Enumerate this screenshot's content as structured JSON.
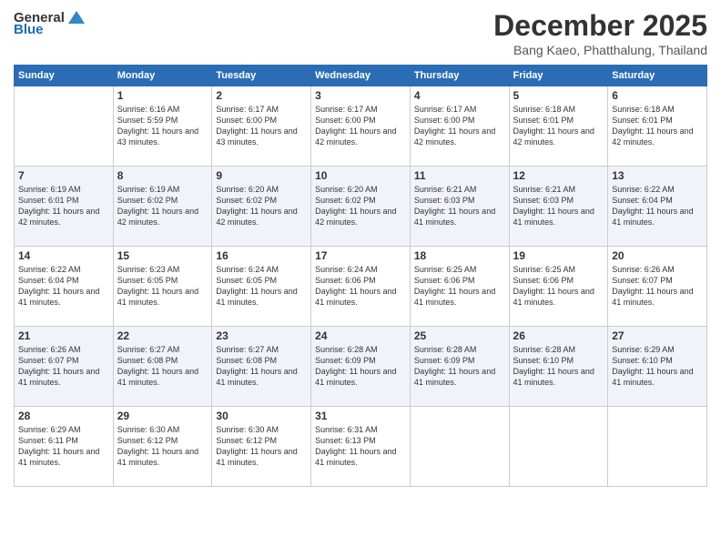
{
  "header": {
    "logo_general": "General",
    "logo_blue": "Blue",
    "month_year": "December 2025",
    "location": "Bang Kaeo, Phatthalung, Thailand"
  },
  "weekdays": [
    "Sunday",
    "Monday",
    "Tuesday",
    "Wednesday",
    "Thursday",
    "Friday",
    "Saturday"
  ],
  "weeks": [
    [
      {
        "day": "",
        "sunrise": "",
        "sunset": "",
        "daylight": ""
      },
      {
        "day": "1",
        "sunrise": "Sunrise: 6:16 AM",
        "sunset": "Sunset: 5:59 PM",
        "daylight": "Daylight: 11 hours and 43 minutes."
      },
      {
        "day": "2",
        "sunrise": "Sunrise: 6:17 AM",
        "sunset": "Sunset: 6:00 PM",
        "daylight": "Daylight: 11 hours and 43 minutes."
      },
      {
        "day": "3",
        "sunrise": "Sunrise: 6:17 AM",
        "sunset": "Sunset: 6:00 PM",
        "daylight": "Daylight: 11 hours and 42 minutes."
      },
      {
        "day": "4",
        "sunrise": "Sunrise: 6:17 AM",
        "sunset": "Sunset: 6:00 PM",
        "daylight": "Daylight: 11 hours and 42 minutes."
      },
      {
        "day": "5",
        "sunrise": "Sunrise: 6:18 AM",
        "sunset": "Sunset: 6:01 PM",
        "daylight": "Daylight: 11 hours and 42 minutes."
      },
      {
        "day": "6",
        "sunrise": "Sunrise: 6:18 AM",
        "sunset": "Sunset: 6:01 PM",
        "daylight": "Daylight: 11 hours and 42 minutes."
      }
    ],
    [
      {
        "day": "7",
        "sunrise": "Sunrise: 6:19 AM",
        "sunset": "Sunset: 6:01 PM",
        "daylight": "Daylight: 11 hours and 42 minutes."
      },
      {
        "day": "8",
        "sunrise": "Sunrise: 6:19 AM",
        "sunset": "Sunset: 6:02 PM",
        "daylight": "Daylight: 11 hours and 42 minutes."
      },
      {
        "day": "9",
        "sunrise": "Sunrise: 6:20 AM",
        "sunset": "Sunset: 6:02 PM",
        "daylight": "Daylight: 11 hours and 42 minutes."
      },
      {
        "day": "10",
        "sunrise": "Sunrise: 6:20 AM",
        "sunset": "Sunset: 6:02 PM",
        "daylight": "Daylight: 11 hours and 42 minutes."
      },
      {
        "day": "11",
        "sunrise": "Sunrise: 6:21 AM",
        "sunset": "Sunset: 6:03 PM",
        "daylight": "Daylight: 11 hours and 41 minutes."
      },
      {
        "day": "12",
        "sunrise": "Sunrise: 6:21 AM",
        "sunset": "Sunset: 6:03 PM",
        "daylight": "Daylight: 11 hours and 41 minutes."
      },
      {
        "day": "13",
        "sunrise": "Sunrise: 6:22 AM",
        "sunset": "Sunset: 6:04 PM",
        "daylight": "Daylight: 11 hours and 41 minutes."
      }
    ],
    [
      {
        "day": "14",
        "sunrise": "Sunrise: 6:22 AM",
        "sunset": "Sunset: 6:04 PM",
        "daylight": "Daylight: 11 hours and 41 minutes."
      },
      {
        "day": "15",
        "sunrise": "Sunrise: 6:23 AM",
        "sunset": "Sunset: 6:05 PM",
        "daylight": "Daylight: 11 hours and 41 minutes."
      },
      {
        "day": "16",
        "sunrise": "Sunrise: 6:24 AM",
        "sunset": "Sunset: 6:05 PM",
        "daylight": "Daylight: 11 hours and 41 minutes."
      },
      {
        "day": "17",
        "sunrise": "Sunrise: 6:24 AM",
        "sunset": "Sunset: 6:06 PM",
        "daylight": "Daylight: 11 hours and 41 minutes."
      },
      {
        "day": "18",
        "sunrise": "Sunrise: 6:25 AM",
        "sunset": "Sunset: 6:06 PM",
        "daylight": "Daylight: 11 hours and 41 minutes."
      },
      {
        "day": "19",
        "sunrise": "Sunrise: 6:25 AM",
        "sunset": "Sunset: 6:06 PM",
        "daylight": "Daylight: 11 hours and 41 minutes."
      },
      {
        "day": "20",
        "sunrise": "Sunrise: 6:26 AM",
        "sunset": "Sunset: 6:07 PM",
        "daylight": "Daylight: 11 hours and 41 minutes."
      }
    ],
    [
      {
        "day": "21",
        "sunrise": "Sunrise: 6:26 AM",
        "sunset": "Sunset: 6:07 PM",
        "daylight": "Daylight: 11 hours and 41 minutes."
      },
      {
        "day": "22",
        "sunrise": "Sunrise: 6:27 AM",
        "sunset": "Sunset: 6:08 PM",
        "daylight": "Daylight: 11 hours and 41 minutes."
      },
      {
        "day": "23",
        "sunrise": "Sunrise: 6:27 AM",
        "sunset": "Sunset: 6:08 PM",
        "daylight": "Daylight: 11 hours and 41 minutes."
      },
      {
        "day": "24",
        "sunrise": "Sunrise: 6:28 AM",
        "sunset": "Sunset: 6:09 PM",
        "daylight": "Daylight: 11 hours and 41 minutes."
      },
      {
        "day": "25",
        "sunrise": "Sunrise: 6:28 AM",
        "sunset": "Sunset: 6:09 PM",
        "daylight": "Daylight: 11 hours and 41 minutes."
      },
      {
        "day": "26",
        "sunrise": "Sunrise: 6:28 AM",
        "sunset": "Sunset: 6:10 PM",
        "daylight": "Daylight: 11 hours and 41 minutes."
      },
      {
        "day": "27",
        "sunrise": "Sunrise: 6:29 AM",
        "sunset": "Sunset: 6:10 PM",
        "daylight": "Daylight: 11 hours and 41 minutes."
      }
    ],
    [
      {
        "day": "28",
        "sunrise": "Sunrise: 6:29 AM",
        "sunset": "Sunset: 6:11 PM",
        "daylight": "Daylight: 11 hours and 41 minutes."
      },
      {
        "day": "29",
        "sunrise": "Sunrise: 6:30 AM",
        "sunset": "Sunset: 6:12 PM",
        "daylight": "Daylight: 11 hours and 41 minutes."
      },
      {
        "day": "30",
        "sunrise": "Sunrise: 6:30 AM",
        "sunset": "Sunset: 6:12 PM",
        "daylight": "Daylight: 11 hours and 41 minutes."
      },
      {
        "day": "31",
        "sunrise": "Sunrise: 6:31 AM",
        "sunset": "Sunset: 6:13 PM",
        "daylight": "Daylight: 11 hours and 41 minutes."
      },
      {
        "day": "",
        "sunrise": "",
        "sunset": "",
        "daylight": ""
      },
      {
        "day": "",
        "sunrise": "",
        "sunset": "",
        "daylight": ""
      },
      {
        "day": "",
        "sunrise": "",
        "sunset": "",
        "daylight": ""
      }
    ]
  ]
}
